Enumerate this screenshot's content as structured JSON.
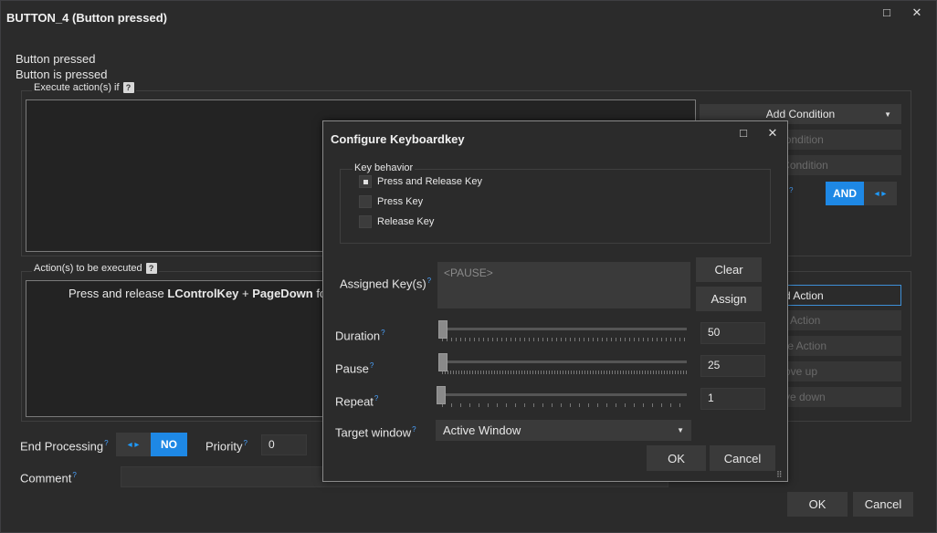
{
  "window": {
    "title": "BUTTON_4 (Button pressed)",
    "maximize_icon": "□",
    "close_icon": "✕"
  },
  "info": {
    "line1": "Button pressed",
    "line2": "Button is pressed"
  },
  "conditions": {
    "legend": "Execute action(s) if",
    "add_condition": "Add Condition",
    "edit_condition": "Condition",
    "delete_condition": "e Condition",
    "and_label": "AND",
    "arrows": "◂ ▸"
  },
  "actions": {
    "legend": "Action(s) to be executed",
    "row_prefix": "Press and release ",
    "row_key1": "LControlKey",
    "row_plus": " + ",
    "row_key2": "PageDown",
    "row_suffix": " fo",
    "add_action": "d Action",
    "edit_action": "t Action",
    "delete_action": "te Action",
    "move_up": "ove up",
    "move_down": "ve down"
  },
  "end_processing": {
    "label": "End Processing",
    "arrows": "◂ ▸",
    "value": "NO"
  },
  "priority": {
    "label": "Priority",
    "value": "0"
  },
  "comment": {
    "label": "Comment"
  },
  "footer": {
    "ok": "OK",
    "cancel": "Cancel"
  },
  "dialog": {
    "title": "Configure Keyboardkey",
    "maximize_icon": "□",
    "close_icon": "✕",
    "key_behavior": {
      "legend": "Key behavior",
      "options": [
        {
          "label": "Press and Release Key",
          "selected": true
        },
        {
          "label": "Press Key",
          "selected": false
        },
        {
          "label": "Release Key",
          "selected": false
        }
      ]
    },
    "assigned": {
      "label": "Assigned Key(s)",
      "placeholder": "<PAUSE>",
      "clear": "Clear",
      "assign": "Assign"
    },
    "duration": {
      "label": "Duration",
      "value": "50"
    },
    "pause": {
      "label": "Pause",
      "value": "25"
    },
    "repeat": {
      "label": "Repeat",
      "value": "1"
    },
    "target": {
      "label": "Target window",
      "value": "Active Window"
    },
    "ok": "OK",
    "cancel": "Cancel",
    "help_sup": "?"
  },
  "icons": {
    "help": "?",
    "caret": "▼",
    "grip": "⠿"
  }
}
